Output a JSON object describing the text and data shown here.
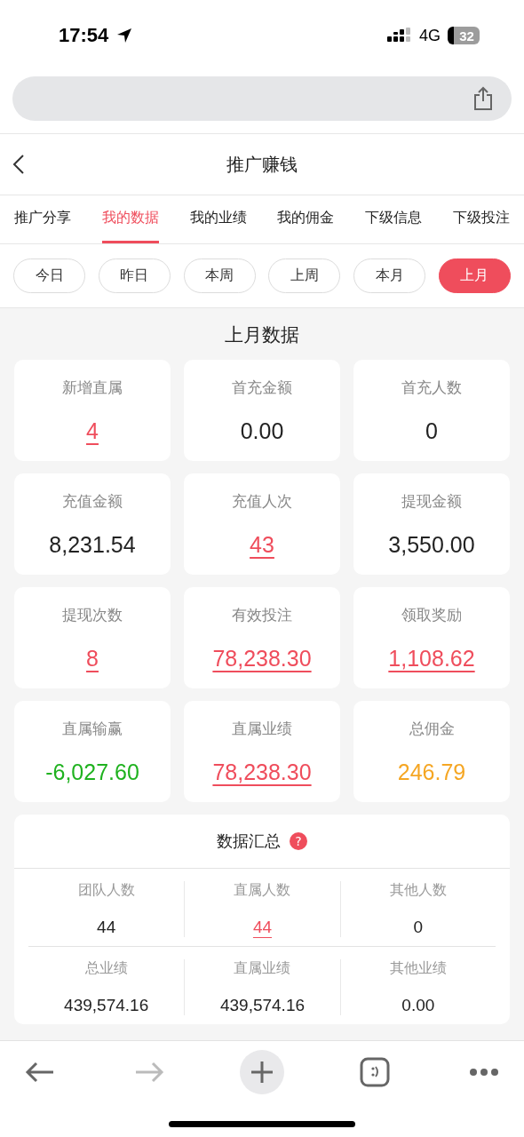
{
  "status_bar": {
    "time": "17:54",
    "network": "4G",
    "battery": "32"
  },
  "header": {
    "title": "推广赚钱"
  },
  "tabs": [
    {
      "label": "推广分享",
      "selected": false
    },
    {
      "label": "我的数据",
      "selected": true
    },
    {
      "label": "我的业绩",
      "selected": false
    },
    {
      "label": "我的佣金",
      "selected": false
    },
    {
      "label": "下级信息",
      "selected": false
    },
    {
      "label": "下级投注",
      "selected": false
    }
  ],
  "periods": [
    {
      "label": "今日",
      "selected": false
    },
    {
      "label": "昨日",
      "selected": false
    },
    {
      "label": "本周",
      "selected": false
    },
    {
      "label": "上周",
      "selected": false
    },
    {
      "label": "本月",
      "selected": false
    },
    {
      "label": "上月",
      "selected": true
    }
  ],
  "section_title": "上月数据",
  "stats": [
    {
      "label": "新增直属",
      "value": "4",
      "link": true,
      "color": "#ef4d5c"
    },
    {
      "label": "首充金额",
      "value": "0.00",
      "link": false,
      "color": "#222222"
    },
    {
      "label": "首充人数",
      "value": "0",
      "link": false,
      "color": "#222222"
    },
    {
      "label": "充值金额",
      "value": "8,231.54",
      "link": false,
      "color": "#222222"
    },
    {
      "label": "充值人次",
      "value": "43",
      "link": true,
      "color": "#ef4d5c"
    },
    {
      "label": "提现金额",
      "value": "3,550.00",
      "link": false,
      "color": "#222222"
    },
    {
      "label": "提现次数",
      "value": "8",
      "link": true,
      "color": "#ef4d5c"
    },
    {
      "label": "有效投注",
      "value": "78,238.30",
      "link": true,
      "color": "#ef4d5c"
    },
    {
      "label": "领取奖励",
      "value": "1,108.62",
      "link": true,
      "color": "#ef4d5c"
    },
    {
      "label": "直属输赢",
      "value": "-6,027.60",
      "link": false,
      "color": "#1fb21f"
    },
    {
      "label": "直属业绩",
      "value": "78,238.30",
      "link": true,
      "color": "#ef4d5c"
    },
    {
      "label": "总佣金",
      "value": "246.79",
      "link": false,
      "color": "#f5a623"
    }
  ],
  "summary": {
    "title": "数据汇总",
    "help": "?",
    "rows": [
      [
        {
          "label": "团队人数",
          "value": "44",
          "link": false
        },
        {
          "label": "直属人数",
          "value": "44",
          "link": true
        },
        {
          "label": "其他人数",
          "value": "0",
          "link": false
        }
      ],
      [
        {
          "label": "总业绩",
          "value": "439,574.16",
          "link": false
        },
        {
          "label": "直属业绩",
          "value": "439,574.16",
          "link": false
        },
        {
          "label": "其他业绩",
          "value": "0.00",
          "link": false
        }
      ]
    ]
  }
}
